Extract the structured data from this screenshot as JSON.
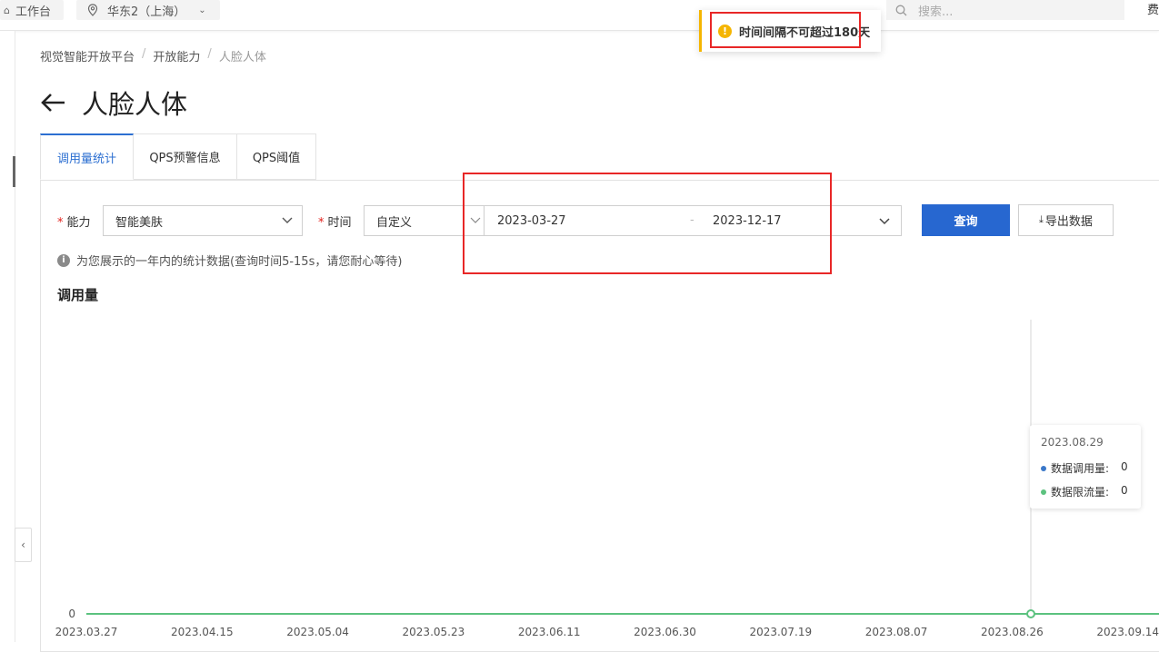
{
  "topbar": {
    "workbench_label": "工作台",
    "region_label": "华东2（上海）",
    "search_placeholder": "搜索...",
    "right_text": "费"
  },
  "toast": {
    "message": "时间间隔不可超过180天",
    "accent_color": "#f5b500"
  },
  "breadcrumb": {
    "items": [
      "视觉智能开放平台",
      "开放能力",
      "人脸人体"
    ],
    "separator": "/"
  },
  "page": {
    "title": "人脸人体"
  },
  "tabs": [
    {
      "label": "调用量统计",
      "active": true
    },
    {
      "label": "QPS预警信息",
      "active": false
    },
    {
      "label": "QPS阈值",
      "active": false
    }
  ],
  "form": {
    "ability_label": "能力",
    "ability_value": "智能美肤",
    "time_label": "时间",
    "time_mode_value": "自定义",
    "start_date": "2023-03-27",
    "range_separator": "-",
    "end_date": "2023-12-17",
    "required_mark": "*",
    "query_button": "查询",
    "export_button": "导出数据",
    "accent_color": "#2767d0"
  },
  "info": {
    "icon": "info-icon",
    "text": "为您展示的一年内的统计数据(查询时间5-15s，请您耐心等待)"
  },
  "chart_section": {
    "title": "调用量"
  },
  "chart_data": {
    "type": "line",
    "title": "调用量",
    "categories": [
      "2023.03.27",
      "2023.04.15",
      "2023.05.04",
      "2023.05.23",
      "2023.06.11",
      "2023.06.30",
      "2023.07.19",
      "2023.08.07",
      "2023.08.26",
      "2023.09.14"
    ],
    "series": [
      {
        "name": "数据调用量",
        "values": [
          0,
          0,
          0,
          0,
          0,
          0,
          0,
          0,
          0,
          0
        ],
        "color": "#3a78c9"
      },
      {
        "name": "数据限流量",
        "values": [
          0,
          0,
          0,
          0,
          0,
          0,
          0,
          0,
          0,
          0
        ],
        "color": "#5cc27f"
      }
    ],
    "y_tick_labels": [
      "0"
    ],
    "grid": false
  },
  "tooltip": {
    "date": "2023.08.29",
    "rows": [
      {
        "name": "数据调用量",
        "value": "0",
        "color": "#3a78c9"
      },
      {
        "name": "数据限流量",
        "value": "0",
        "color": "#5cc27f"
      }
    ]
  }
}
